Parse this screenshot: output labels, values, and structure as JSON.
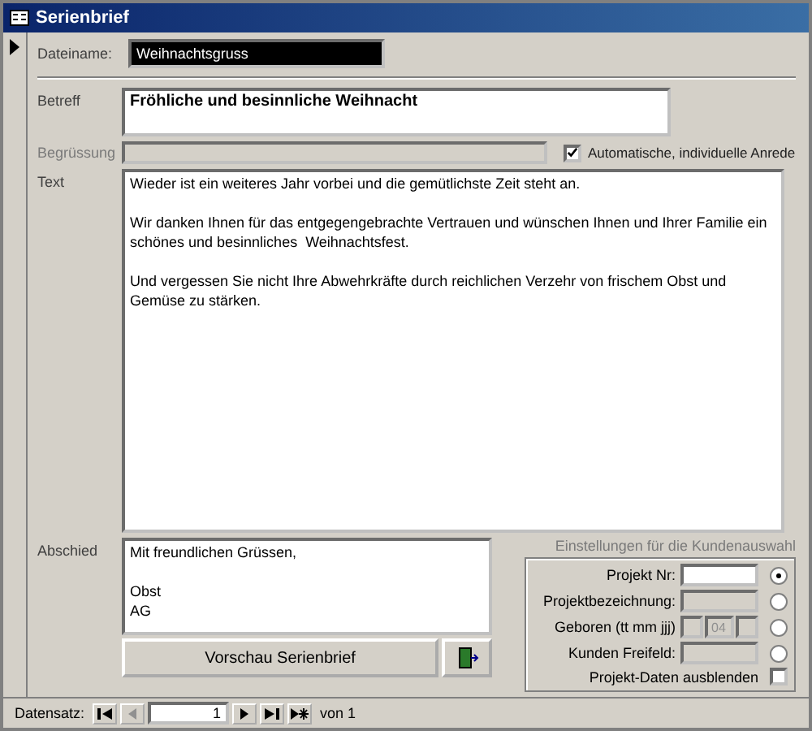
{
  "window": {
    "title": "Serienbrief"
  },
  "dateiname": {
    "label": "Dateiname:",
    "value": "Weihnachtsgruss",
    "selected": true
  },
  "betreff": {
    "label": "Betreff",
    "value": "Fröhliche und besinnliche Weihnacht"
  },
  "begruessung": {
    "label": "Begrüssung",
    "disabled": true
  },
  "anrede": {
    "label": "Automatische, individuelle Anrede",
    "checked": true
  },
  "text": {
    "label": "Text",
    "value": "Wieder ist ein weiteres Jahr vorbei und die gemütlichste Zeit steht an.\n\nWir danken Ihnen für das entgegengebrachte Vertrauen und wünschen Ihnen und Ihrer Familie ein\nschönes und besinnliches  Weihnachtsfest.\n\nUnd vergessen Sie nicht Ihre Abwehrkräfte durch reichlichen Verzehr von frischem Obst und\nGemüse zu stärken."
  },
  "abschied": {
    "label": "Abschied",
    "value": "Mit freundlichen Grüssen,\n\nObst\nAG"
  },
  "preview_button": {
    "label": "Vorschau Serienbrief"
  },
  "kundenauswahl": {
    "title": "Einstellungen für die Kundenauswahl",
    "title_disabled": true,
    "options": [
      {
        "label": "Projekt Nr:",
        "kind": "text",
        "disabled": false,
        "selected": true
      },
      {
        "label": "Projektbezeichnung:",
        "kind": "text",
        "disabled": true,
        "selected": false
      },
      {
        "label": "Geboren (tt mm jjj)",
        "kind": "date",
        "month": "04",
        "disabled": true,
        "selected": false
      },
      {
        "label": "Kunden Freifeld:",
        "kind": "text",
        "disabled": true,
        "selected": false
      }
    ],
    "hide": {
      "label": "Projekt-Daten ausblenden",
      "checked": false
    }
  },
  "navigation": {
    "label": "Datensatz:",
    "current": "1",
    "total": "von 1",
    "before": [
      {
        "kind": "first",
        "disabled": false
      },
      {
        "kind": "prev",
        "disabled": true
      }
    ],
    "after": [
      {
        "kind": "next",
        "disabled": false
      },
      {
        "kind": "last",
        "disabled": false
      },
      {
        "kind": "new",
        "disabled": false
      }
    ]
  }
}
